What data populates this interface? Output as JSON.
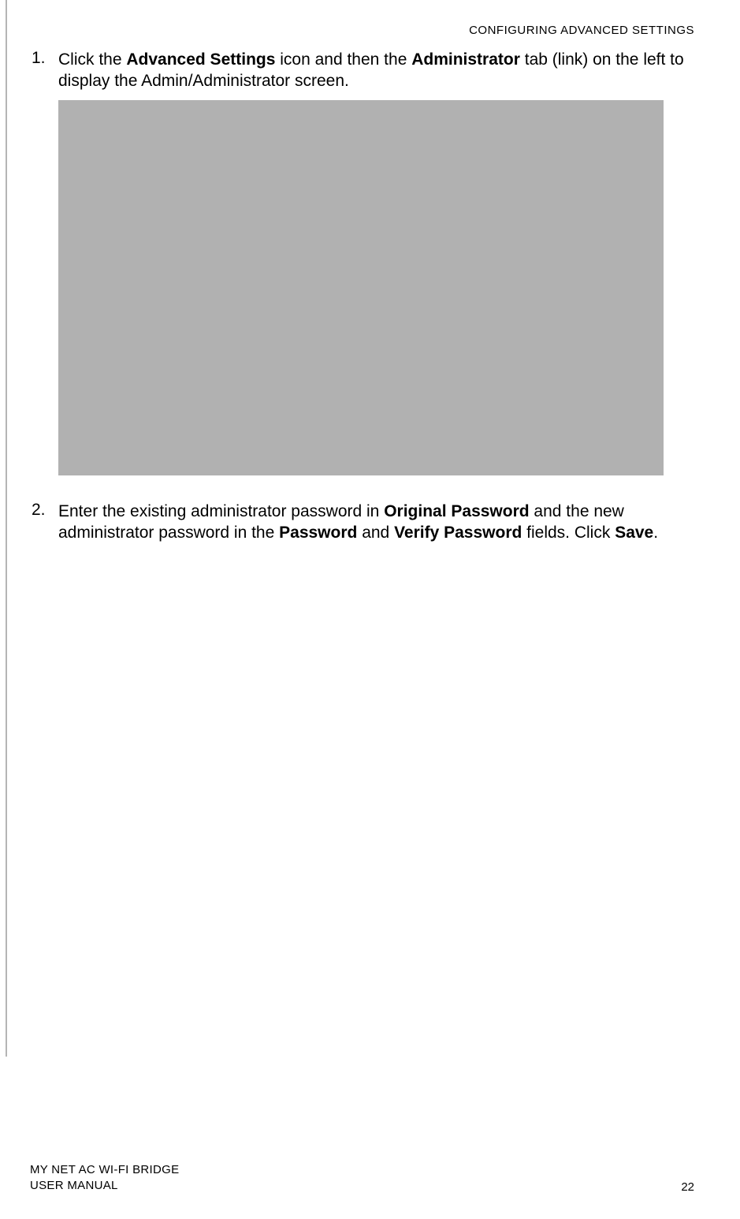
{
  "header": {
    "section_title": "CONFIGURING ADVANCED SETTINGS"
  },
  "steps": {
    "step1": {
      "number": "1.",
      "text_prefix": "Click the ",
      "bold1": "Advanced Settings",
      "text_mid1": " icon and then the ",
      "bold2": "Administrator",
      "text_suffix": " tab (link) on the left to display the Admin/Administrator screen."
    },
    "step2": {
      "number": "2.",
      "text_prefix": " Enter the existing administrator password in ",
      "bold1": "Original Password",
      "text_mid1": " and the new administrator password in the ",
      "bold2": "Password",
      "text_mid2": " and ",
      "bold3": "Verify Password",
      "text_mid3": " fields. Click ",
      "bold4": "Save",
      "text_suffix": "."
    }
  },
  "footer": {
    "product_line1": "MY NET AC WI-FI BRIDGE",
    "product_line2": "USER MANUAL",
    "page_number": "22"
  }
}
